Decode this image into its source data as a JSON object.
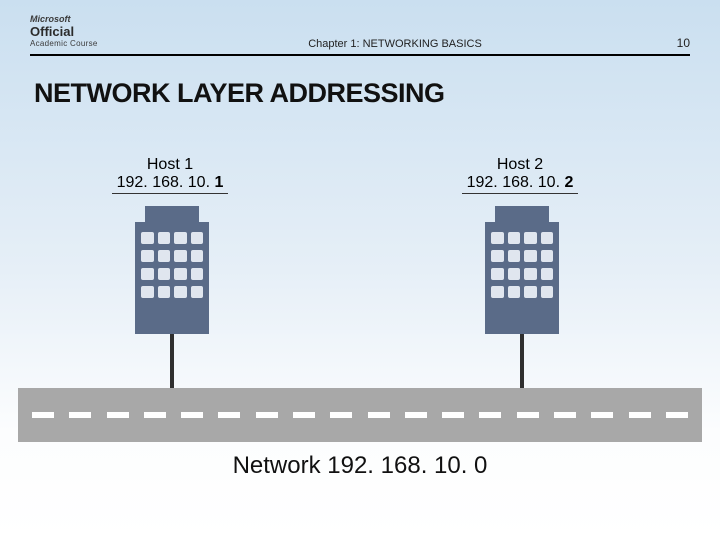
{
  "header": {
    "logo": {
      "line1": "Microsoft",
      "line2": "Official",
      "line3": "Academic Course"
    },
    "chapter": "Chapter 1: NETWORKING BASICS",
    "page": "10"
  },
  "title": "NETWORK LAYER ADDRESSING",
  "diagram": {
    "host1": {
      "name": "Host 1",
      "ip_prefix": "192. 168. 10. ",
      "ip_last": "1"
    },
    "host2": {
      "name": "Host 2",
      "ip_prefix": "192. 168. 10. ",
      "ip_last": "2"
    },
    "network_label_prefix": "Network  ",
    "network_ip": "192. 168. 10. 0"
  }
}
